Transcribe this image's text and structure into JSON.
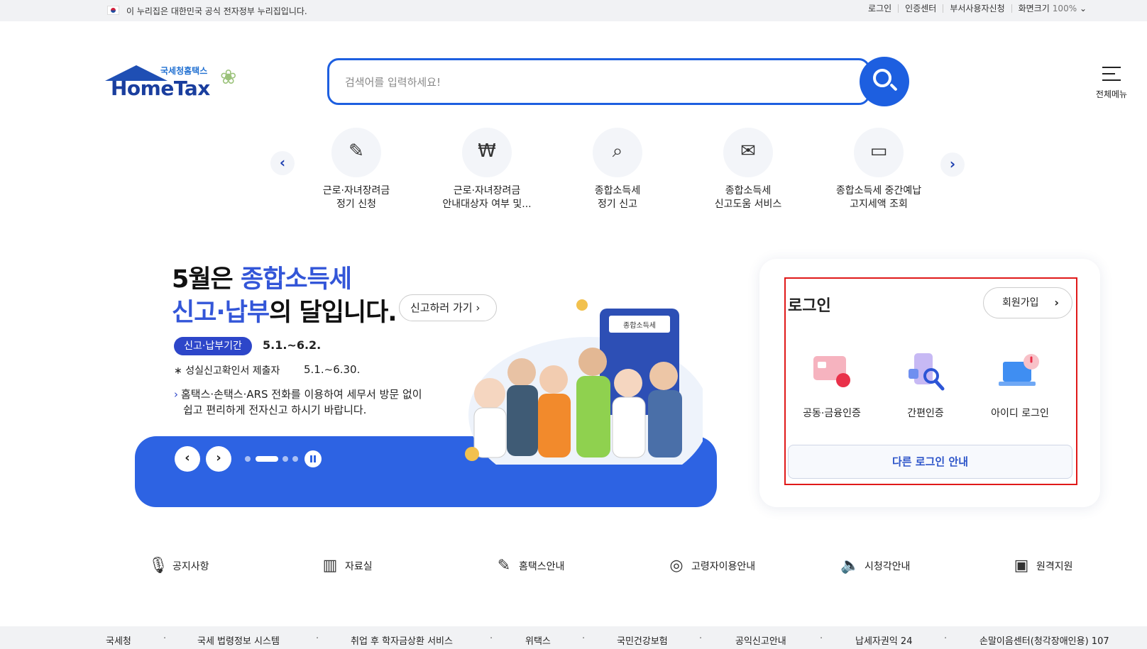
{
  "gov_bar": {
    "notice": "이 누리집은 대한민국 공식 전자정부 누리집입니다.",
    "links": [
      "로그인",
      "인증센터",
      "부서사용자신청",
      "화면크기"
    ],
    "zoom": "100%"
  },
  "header": {
    "logo_sub": "국세청홈택스",
    "logo_main": "HomeTax",
    "search_placeholder": "검색어를 입력하세요!",
    "all_menu_label": "전체메뉴"
  },
  "quick_menu": [
    {
      "line1": "근로·자녀장려금",
      "line2": "정기 신청",
      "icon": "document-pen-icon"
    },
    {
      "line1": "근로·자녀장려금",
      "line2": "안내대상자 여부 및...",
      "icon": "won-chat-icon"
    },
    {
      "line1": "종합소득세",
      "line2": "정기 신고",
      "icon": "tax-search-icon"
    },
    {
      "line1": "종합소득세",
      "line2": "신고도움 서비스",
      "icon": "tax-envelope-icon"
    },
    {
      "line1": "종합소득세 중간예납",
      "line2": "고지세액 조회",
      "icon": "monitor-search-icon"
    }
  ],
  "banner": {
    "headline_1_plain": "5월은 ",
    "headline_1_accent": "종합소득세",
    "headline_2_accent": "신고·납부",
    "headline_2_plain": "의 달입니다.",
    "go_button": "신고하러 가기",
    "period_badge": "신고·납부기간",
    "period_date": "5.1.~6.2.",
    "note_label": "성실신고확인서 제출자",
    "note_date": "5.1.~6.30.",
    "desc_line1": "홈택스·손택스·ARS 전화를 이용하여 세무서 방문 없이",
    "desc_line2": "쉽고 편리하게 전자신고 하시기 바랍니다.",
    "calculator_label": "종합소득세"
  },
  "login": {
    "title": "로그인",
    "join_button": "회원가입",
    "methods": [
      "공동·금융인증",
      "간편인증",
      "아이디 로그인"
    ],
    "other_login": "다른 로그인 안내"
  },
  "utility_links": [
    {
      "label": "공지사항",
      "icon": "microphone-icon"
    },
    {
      "label": "자료실",
      "icon": "archive-icon"
    },
    {
      "label": "홈택스안내",
      "icon": "guide-pen-icon"
    },
    {
      "label": "고령자이용안내",
      "icon": "elderly-glasses-icon"
    },
    {
      "label": "시청각안내",
      "icon": "speaker-icon"
    },
    {
      "label": "원격지원",
      "icon": "remote-monitor-icon"
    }
  ],
  "footer_links": [
    "국세청",
    "국세 법령정보 시스템",
    "취업 후 학자금상환 서비스",
    "위택스",
    "국민건강보험",
    "공익신고안내",
    "납세자권익 24",
    "손말이음센터(청각장애인용) 107"
  ],
  "colors": {
    "primary": "#1d5fe0",
    "banner_blue": "#2d63e3",
    "accent_text": "#3356d8",
    "highlight_box": "#e01919"
  }
}
